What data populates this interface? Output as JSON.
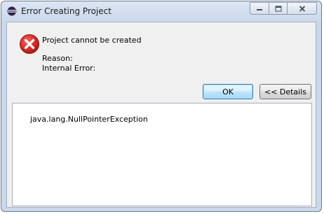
{
  "window": {
    "title": "Error Creating Project"
  },
  "dialog": {
    "message": "Project cannot be created",
    "reason_label": "Reason:",
    "internal_error_label": "Internal Error:",
    "ok_label": "OK",
    "details_label": "<< Details",
    "details_text": "java.lang.NullPointerException"
  },
  "icons": {
    "app": "eclipse-icon",
    "error": "error-icon",
    "minimize": "minimize-icon",
    "maximize": "maximize-icon",
    "close": "close-icon"
  },
  "colors": {
    "error_red": "#d9302b",
    "ok_border": "#3c7fb1",
    "title_bg": "#c9d8ea"
  }
}
